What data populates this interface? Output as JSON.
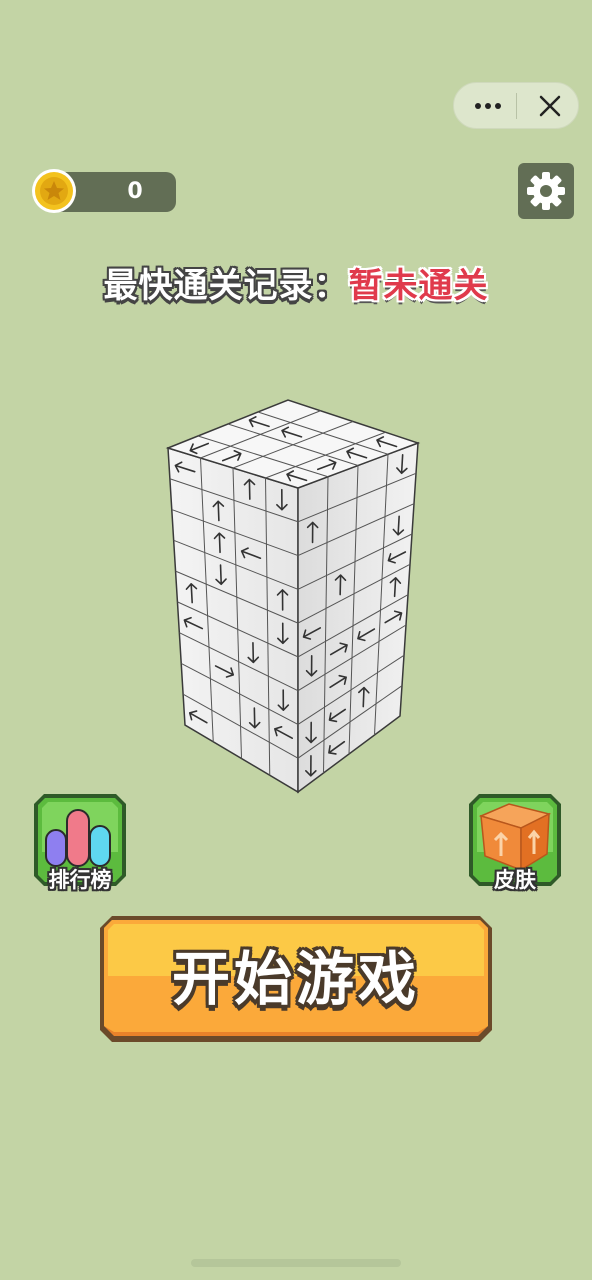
{
  "coins": {
    "value": "0"
  },
  "record": {
    "label": "最快通关记录：",
    "value": "暂未通关"
  },
  "buttons": {
    "leaderboard": "排行榜",
    "skins": "皮肤",
    "start": "开始游戏"
  },
  "icons": {
    "menu": "more-dots-icon",
    "close": "close-icon",
    "settings": "gear-icon",
    "coin": "coin-star-icon"
  },
  "colors": {
    "background": "#c3d4a5",
    "record_value": "#e03a4c",
    "start_button": "#fba93a",
    "panel": "#626e55"
  }
}
